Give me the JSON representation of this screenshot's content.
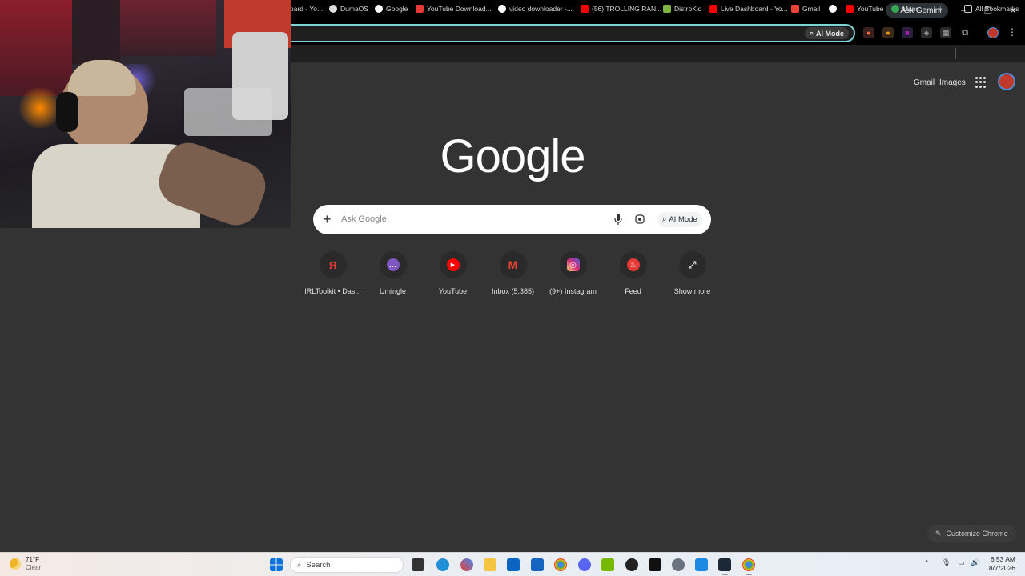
{
  "titlebar": {
    "ask_gemini": "Ask Gemini",
    "minimize": "–",
    "restore": "❐",
    "close": "✕"
  },
  "omnibox": {
    "ai_mode": "AI Mode"
  },
  "bookmarks": {
    "items": [
      {
        "label": "oard - Yo...",
        "color": "#888888"
      },
      {
        "label": "DumaOS",
        "color": "#ffffff"
      },
      {
        "label": "Google",
        "color": "#ffffff"
      },
      {
        "label": "YouTube Download...",
        "color": "#e53935"
      },
      {
        "label": "video downloader -...",
        "color": "#ffffff"
      },
      {
        "label": "(56) TROLLING RAN...",
        "color": "#ff0000"
      },
      {
        "label": "DistroKid",
        "color": "#7cb342"
      },
      {
        "label": "Live Dashboard - Yo...",
        "color": "#ff0000"
      },
      {
        "label": "Gmail",
        "color": "#ea4335"
      },
      {
        "label": "",
        "color": "#ffffff"
      },
      {
        "label": "YouTube",
        "color": "#ff0000"
      },
      {
        "label": "Maps",
        "color": "#34a853"
      }
    ],
    "overflow": "»",
    "all_bookmarks": "All Bookmarks"
  },
  "page": {
    "gmail_link": "Gmail",
    "images_link": "Images",
    "logo": "Google",
    "search_placeholder": "Ask Google",
    "search_ai_mode": "AI Mode",
    "shortcuts": [
      {
        "label": "IRLToolkit • Das...",
        "glyph": "Я",
        "color": "#c62828"
      },
      {
        "label": "Umingle",
        "glyph": "…",
        "color": "#7e57c2"
      },
      {
        "label": "YouTube",
        "glyph": "▶",
        "color": "#ff0000"
      },
      {
        "label": "Inbox (5,385)",
        "glyph": "M",
        "color": "#ea4335"
      },
      {
        "label": "(9+) Instagram",
        "glyph": "◎",
        "color": "#d62976"
      },
      {
        "label": "Feed",
        "glyph": "♨",
        "color": "#e53935"
      },
      {
        "label": "Show more",
        "glyph": "⤢",
        "color": "#2a2a2a"
      }
    ],
    "customize": "Customize Chrome"
  },
  "taskbar": {
    "temperature": "71°F",
    "condition": "Clear",
    "search": "Search",
    "time": "6:53 AM",
    "date": "8/7/2026",
    "tray_up": "^"
  }
}
